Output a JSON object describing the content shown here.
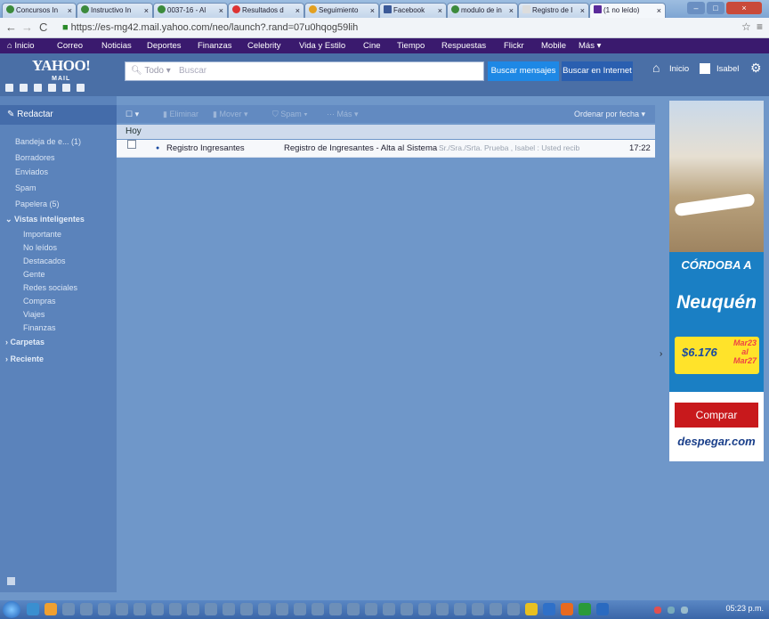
{
  "browser": {
    "tabs": [
      {
        "label": "Concursos In",
        "active": false
      },
      {
        "label": "Instructivo In",
        "active": false
      },
      {
        "label": "0037-16 - Al",
        "active": false
      },
      {
        "label": "Resultados d",
        "active": false
      },
      {
        "label": "Seguimiento",
        "active": false
      },
      {
        "label": "Facebook",
        "active": false
      },
      {
        "label": "modulo de in",
        "active": false
      },
      {
        "label": "Registro de I",
        "active": false
      },
      {
        "label": "(1 no leído)",
        "active": true
      }
    ],
    "url": "https://es-mg42.mail.yahoo.com/neo/launch?.rand=07u0hqog59lih",
    "close_glyph": "×",
    "window_buttons": {
      "minimize": "–",
      "maximize": "□",
      "close": "×"
    }
  },
  "yahoo_nav": [
    "Inicio",
    "Correo",
    "Noticias",
    "Deportes",
    "Finanzas",
    "Celebrity",
    "Vida y Estilo",
    "Cine",
    "Tiempo",
    "Respuestas",
    "Flickr",
    "Mobile",
    "Más ▾"
  ],
  "header": {
    "logo": "YAHOO!",
    "logo_sub": "MAIL",
    "search_scope": "Todo",
    "search_placeholder": "Buscar",
    "btn_search_messages": "Buscar mensajes",
    "btn_search_web": "Buscar en Internet",
    "home_label": "Inicio",
    "user_name": "Isabel"
  },
  "sidebar": {
    "compose": "Redactar",
    "folders": [
      {
        "label": "Bandeja de e... (1)"
      },
      {
        "label": "Borradores"
      },
      {
        "label": "Enviados"
      },
      {
        "label": "Spam"
      },
      {
        "label": "Papelera (5)"
      }
    ],
    "smart_views_header": "Vistas inteligentes",
    "smart_views": [
      "Importante",
      "No leídos",
      "Destacados",
      "Gente",
      "Redes sociales",
      "Compras",
      "Viajes",
      "Finanzas"
    ],
    "folders_header": "Carpetas",
    "recent_header": "Reciente"
  },
  "toolbar": {
    "delete": "Eliminar",
    "move": "Mover ▾",
    "spam": "Spam ▾",
    "more": "Más ▾",
    "sort": "Ordenar por fecha ▾"
  },
  "messages": {
    "date_group": "Hoy",
    "items": [
      {
        "sender": "Registro Ingresantes",
        "subject": "Registro de Ingresantes - Alta al Sistema",
        "snippet": "Sr./Sra./Srta. Prueba , Isabel : Usted recib",
        "time": "17:22",
        "unread": true
      }
    ]
  },
  "ad": {
    "line1": "CÓRDOBA A",
    "line2": "Neuquén",
    "price": "$6.176",
    "dates": "Mar23 al Mar27",
    "button": "Comprar",
    "brand": "despegar.com"
  },
  "taskbar": {
    "clock": "05:23 p.m."
  }
}
